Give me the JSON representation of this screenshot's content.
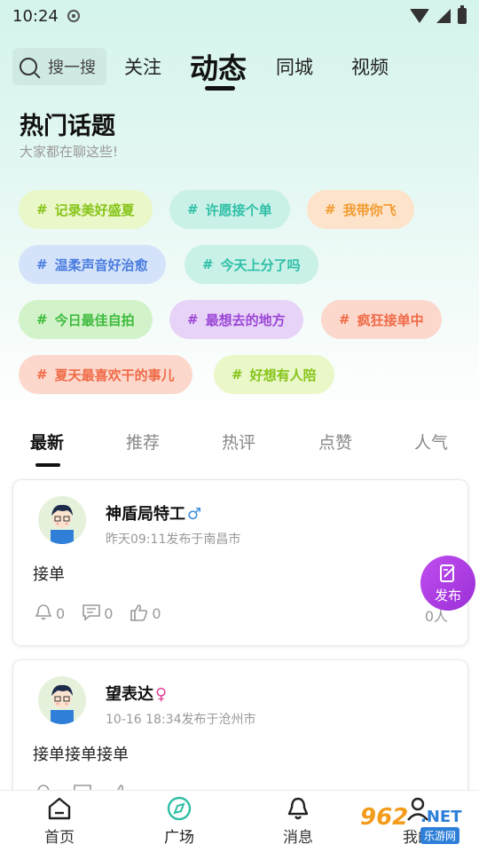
{
  "status_bar": {
    "time": "10:24"
  },
  "top_nav": {
    "search_placeholder": "搜一搜",
    "tabs": [
      "关注",
      "动态",
      "同城",
      "视频"
    ],
    "active_tab": "动态"
  },
  "hot_topics": {
    "title": "热门话题",
    "subtitle": "大家都在聊这些!",
    "tags": [
      {
        "label": "记录美好盛夏",
        "color": "#86c418",
        "bg": "#eaf7c9"
      },
      {
        "label": "许愿接个单",
        "color": "#2fbfa6",
        "bg": "#c9f1e8"
      },
      {
        "label": "我带你飞",
        "color": "#f29b30",
        "bg": "#fde3c9"
      },
      {
        "label": "温柔声音好治愈",
        "color": "#4a7de0",
        "bg": "#d4e3f9"
      },
      {
        "label": "今天上分了吗",
        "color": "#2fbfa6",
        "bg": "#c9f1e8"
      },
      {
        "label": "今日最佳自拍",
        "color": "#3dbb3d",
        "bg": "#d2f3c9"
      },
      {
        "label": "最想去的地方",
        "color": "#9b46d6",
        "bg": "#e7d3f7"
      },
      {
        "label": "疯狂接单中",
        "color": "#f06a47",
        "bg": "#fcd8cc"
      },
      {
        "label": "夏天最喜欢干的事儿",
        "color": "#f06a47",
        "bg": "#fcd8cc"
      },
      {
        "label": "好想有人陪",
        "color": "#86c418",
        "bg": "#eaf7c9"
      }
    ]
  },
  "feed_tabs": {
    "tabs": [
      "最新",
      "推荐",
      "热评",
      "点赞",
      "人气"
    ],
    "active": "最新"
  },
  "posts": [
    {
      "username": "神盾局特工",
      "gender_symbol": "♂",
      "meta": "昨天09:11发布于南昌市",
      "text": "接单",
      "likes_bell": "0",
      "comments": "0",
      "thumbs": "0",
      "popularity": "0人"
    },
    {
      "username": "望表达",
      "gender_symbol": "♀",
      "meta": "10-16 18:34发布于沧州市",
      "text": "接单接单接单"
    }
  ],
  "fab": {
    "label": "发布"
  },
  "bottom_nav": {
    "items": [
      "首页",
      "广场",
      "消息",
      "我的"
    ],
    "active": "广场"
  },
  "watermark": {
    "number": "962",
    "domain": ".NET",
    "sub": "乐游网"
  },
  "colors": {
    "accent_teal": "#2fbfa6",
    "fab_purple": "#b040e6",
    "header_gradient_top": "#d4f4ec"
  }
}
